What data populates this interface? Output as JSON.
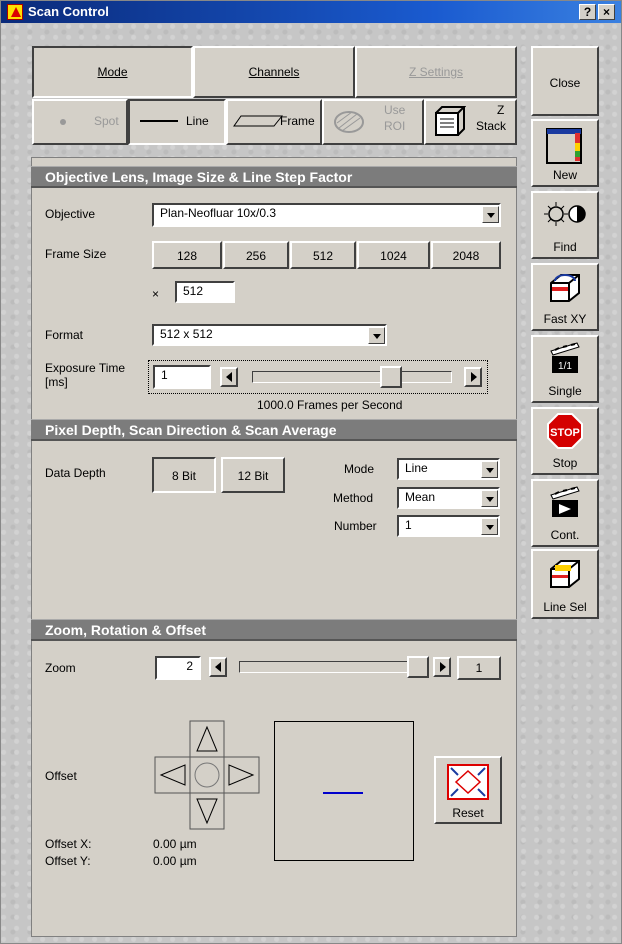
{
  "window": {
    "title": "Scan Control",
    "help": "?",
    "close": "×"
  },
  "tabs": {
    "mode": "Mode",
    "channels": "Channels",
    "zsettings": "Z Settings"
  },
  "modes": {
    "spot": "Spot",
    "line": "Line",
    "frame": "Frame",
    "use_roi_1": "Use",
    "use_roi_2": "ROI",
    "zstack_1": "Z",
    "zstack_2": "Stack"
  },
  "side": {
    "close": "Close",
    "new": "New",
    "find": "Find",
    "fastxy": "Fast XY",
    "single": "Single",
    "stop": "Stop",
    "stop_sign": "STOP",
    "cont": "Cont.",
    "linesel": "Line Sel",
    "single_icon_text": "1/1"
  },
  "sec1": {
    "title": "Objective Lens, Image Size & Line Step Factor",
    "objective_label": "Objective",
    "objective_value": "Plan-Neofluar 10x/0.3",
    "frame_size_label": "Frame Size",
    "sizes": [
      "128",
      "256",
      "512",
      "1024",
      "2048"
    ],
    "x_label": "×",
    "x_value": "512",
    "format_label": "Format",
    "format_value": "512 x 512",
    "exposure_label_1": "Exposure Time",
    "exposure_label_2": "[ms]",
    "exposure_value": "1",
    "fps_text": "1000.0 Frames per Second",
    "exposure_slider_fraction": 0.72
  },
  "sec2": {
    "title": "Pixel Depth, Scan Direction & Scan Average",
    "data_depth_label": "Data Depth",
    "bit8": "8 Bit",
    "bit12": "12 Bit",
    "mode_label": "Mode",
    "mode_value": "Line",
    "method_label": "Method",
    "method_value": "Mean",
    "number_label": "Number",
    "number_value": "1"
  },
  "sec3": {
    "title": "Zoom, Rotation & Offset",
    "zoom_label": "Zoom",
    "zoom_value": "2",
    "zoom_right": "1",
    "zoom_slider_fraction": 1.0,
    "offset_label": "Offset",
    "offset_x_label": "Offset X:",
    "offset_x_value": "0.00 µm",
    "offset_y_label": "Offset Y:",
    "offset_y_value": "0.00 µm",
    "reset": "Reset"
  },
  "colors": {
    "titlebar": "#0a2a7a",
    "section": "#7c7c7c",
    "stop": "#d40000",
    "scanline": "#0000cc"
  }
}
